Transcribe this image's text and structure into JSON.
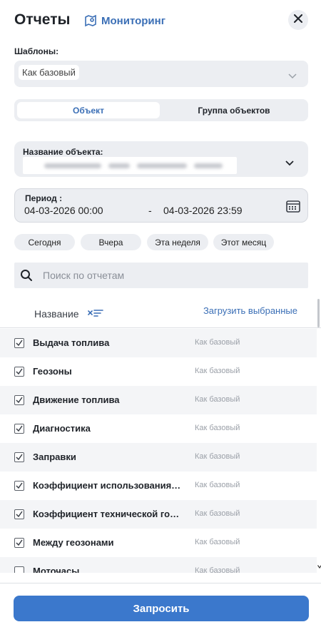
{
  "header": {
    "title": "Отчеты",
    "monitoring_link": "Мониторинг"
  },
  "templates": {
    "label": "Шаблоны:",
    "value": "Как базовый"
  },
  "segment": {
    "object": "Объект",
    "group": "Группа объектов"
  },
  "object_field": {
    "label": "Название объекта:"
  },
  "period": {
    "label": "Период :",
    "from": "04-03-2026 00:00",
    "dash": "-",
    "to": "04-03-2026 23:59"
  },
  "quick_ranges": [
    "Сегодня",
    "Вчера",
    "Эта неделя",
    "Этот месяц"
  ],
  "search": {
    "placeholder": "Поиск по отчетам"
  },
  "list_header": {
    "name": "Название",
    "load_selected": "Загрузить выбранные"
  },
  "reports": [
    {
      "name": "Выдача топлива",
      "template": "Как базовый"
    },
    {
      "name": "Геозоны",
      "template": "Как базовый"
    },
    {
      "name": "Движение топлива",
      "template": "Как базовый"
    },
    {
      "name": "Диагностика",
      "template": "Как базовый"
    },
    {
      "name": "Заправки",
      "template": "Как базовый"
    },
    {
      "name": "Коэффициент использования …",
      "template": "Как базовый"
    },
    {
      "name": "Коэффициент технической го…",
      "template": "Как базовый"
    },
    {
      "name": "Между геозонами",
      "template": "Как базовый"
    },
    {
      "name": "Моточасы",
      "template": "Как базовый"
    }
  ],
  "footer": {
    "submit": "Запросить"
  },
  "colors": {
    "accent": "#3b78cc",
    "link": "#3b6fb6",
    "field_bg": "#eceef2"
  }
}
